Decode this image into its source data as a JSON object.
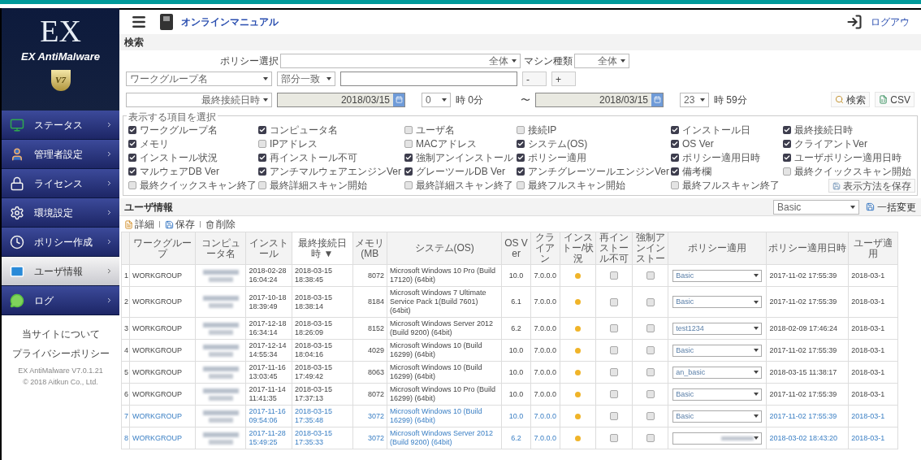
{
  "top_bar": {
    "manual_link": "オンラインマニュアル",
    "logout_link": "ログアウ"
  },
  "sidebar": {
    "logo_text": "EX",
    "product_name": "EX AntiMalware",
    "badge": "V7",
    "items": [
      {
        "kind": "status",
        "label": "ステータス",
        "selected": false
      },
      {
        "kind": "admin",
        "label": "管理者設定",
        "selected": false
      },
      {
        "kind": "license",
        "label": "ライセンス",
        "selected": false
      },
      {
        "kind": "settings",
        "label": "環境設定",
        "selected": false
      },
      {
        "kind": "policy",
        "label": "ポリシー作成",
        "selected": false
      },
      {
        "kind": "users",
        "label": "ユーザ情報",
        "selected": true
      },
      {
        "kind": "log",
        "label": "ログ",
        "selected": false
      }
    ],
    "footer_links": [
      "当サイトについて",
      "プライバシーポリシー"
    ],
    "version": "EX AntiMalware V7.0.1.21",
    "copyright": "© 2018 Aitkun Co., Ltd."
  },
  "search": {
    "title": "検索",
    "policy_label": "ポリシー選択",
    "policy_value": "全体",
    "machine_label": "マシン種類",
    "machine_value": "全体",
    "field_select": "ワークグループ名",
    "match_select": "部分一致",
    "minus_button": "-",
    "plus_button": "+",
    "date_select": "最終接続日時",
    "from_date": "2018/03/15",
    "from_hour": "0",
    "from_suffix": "時 0分",
    "range_mark": "〜",
    "to_date": "2018/03/15",
    "to_hour": "23",
    "to_suffix": "時 59分",
    "search_button": "検索",
    "csv_button": "CSV"
  },
  "columns_panel": {
    "legend": "表示する項目を選択",
    "save_button": "表示方法を保存",
    "options": [
      {
        "label": "ワークグループ名",
        "checked": true
      },
      {
        "label": "コンピュータ名",
        "checked": true
      },
      {
        "label": "ユーザ名",
        "checked": false
      },
      {
        "label": "接続IP",
        "checked": false
      },
      {
        "label": "インストール日",
        "checked": true
      },
      {
        "label": "最終接続日時",
        "checked": true
      },
      {
        "label": "メモリ",
        "checked": true
      },
      {
        "label": "IPアドレス",
        "checked": false
      },
      {
        "label": "MACアドレス",
        "checked": false
      },
      {
        "label": "システム(OS)",
        "checked": true
      },
      {
        "label": "OS Ver",
        "checked": true
      },
      {
        "label": "クライアントVer",
        "checked": true
      },
      {
        "label": "インストール状況",
        "checked": true
      },
      {
        "label": "再インストール不可",
        "checked": true
      },
      {
        "label": "強制アンインストール",
        "checked": true
      },
      {
        "label": "ポリシー適用",
        "checked": true
      },
      {
        "label": "ポリシー適用日時",
        "checked": true
      },
      {
        "label": "ユーザポリシー適用日時",
        "checked": true
      },
      {
        "label": "マルウェアDB Ver",
        "checked": true
      },
      {
        "label": "アンチマルウェアエンジンVer",
        "checked": true
      },
      {
        "label": "グレーツールDB Ver",
        "checked": true
      },
      {
        "label": "アンチグレーツールエンジンVer",
        "checked": true
      },
      {
        "label": "備考欄",
        "checked": true
      },
      {
        "label": "最終クイックスキャン開始",
        "checked": false
      },
      {
        "label": "最終クイックスキャン終了",
        "checked": false
      },
      {
        "label": "最終詳細スキャン開始",
        "checked": false
      },
      {
        "label": "最終詳細スキャン終了",
        "checked": false
      },
      {
        "label": "最終フルスキャン開始",
        "checked": false
      },
      {
        "label": "最終フルスキャン終了",
        "checked": false
      }
    ]
  },
  "user_info": {
    "title": "ユーザ情報",
    "bulk_select": "Basic",
    "bulk_button": "一括変更",
    "toolbar": [
      {
        "kind": "details",
        "label": "詳細"
      },
      {
        "kind": "save",
        "label": "保存"
      },
      {
        "kind": "delete",
        "label": "削除"
      }
    ],
    "columns": [
      "ワークグループ",
      "コンピュータ名",
      "インストール",
      "最終接続日時 ▼",
      "メモリ(MB",
      "システム(OS)",
      "OS Ver",
      "クライアン",
      "インストー/状況",
      "再インストール不可",
      "強制アンインストー",
      "ポリシー適用",
      "ポリシー適用日時",
      "ユーザ適用"
    ],
    "rows": [
      {
        "no": "1",
        "workgroup": "WORKGROUP",
        "install_date": "2018-02-28 16:04:24",
        "last_connection": "2018-03-15 18:38:45",
        "memory": "8072",
        "os": "Microsoft Windows 10 Pro (Build 17120) (64bit)",
        "os_ver": "10.0",
        "client_ver": "7.0.0.0",
        "reinstall_blocked": false,
        "force_uninstall": false,
        "policy": "Basic",
        "policy_date": "2017-11-02 17:55:39",
        "user_policy_date": "2018-03-1",
        "highlighted": false
      },
      {
        "no": "2",
        "workgroup": "WORKGROUP",
        "install_date": "2017-10-18 18:39:49",
        "last_connection": "2018-03-15 18:38:14",
        "memory": "8184",
        "os": "Microsoft Windows 7 Ultimate Service Pack 1(Build 7601) (64bit)",
        "os_ver": "6.1",
        "client_ver": "7.0.0.0",
        "reinstall_blocked": false,
        "force_uninstall": false,
        "policy": "Basic",
        "policy_date": "2017-11-02 17:55:39",
        "user_policy_date": "2018-03-1",
        "highlighted": false
      },
      {
        "no": "3",
        "workgroup": "WORKGROUP",
        "install_date": "2017-12-18 16:34:14",
        "last_connection": "2018-03-15 18:26:09",
        "memory": "8152",
        "os": "Microsoft Windows Server 2012 (Build 9200) (64bit)",
        "os_ver": "6.2",
        "client_ver": "7.0.0.0",
        "reinstall_blocked": false,
        "force_uninstall": false,
        "policy": "test1234",
        "policy_date": "2018-02-09 17:46:24",
        "user_policy_date": "2018-03-1",
        "highlighted": false
      },
      {
        "no": "4",
        "workgroup": "WORKGROUP",
        "install_date": "2017-12-14 14:55:34",
        "last_connection": "2018-03-15 18:04:16",
        "memory": "4029",
        "os": "Microsoft Windows 10 (Build 16299) (64bit)",
        "os_ver": "10.0",
        "client_ver": "7.0.0.0",
        "reinstall_blocked": false,
        "force_uninstall": false,
        "policy": "Basic",
        "policy_date": "2017-11-02 17:55:39",
        "user_policy_date": "2018-03-1",
        "highlighted": false
      },
      {
        "no": "5",
        "workgroup": "WORKGROUP",
        "install_date": "2017-11-16 13:03:45",
        "last_connection": "2018-03-15 17:49:42",
        "memory": "8063",
        "os": "Microsoft Windows 10 (Build 16299) (64bit)",
        "os_ver": "10.0",
        "client_ver": "7.0.0.0",
        "reinstall_blocked": false,
        "force_uninstall": false,
        "policy": "an_basic",
        "policy_date": "2018-03-15 11:38:17",
        "user_policy_date": "2018-03-1",
        "highlighted": false
      },
      {
        "no": "6",
        "workgroup": "WORKGROUP",
        "install_date": "2017-11-14 11:41:35",
        "last_connection": "2018-03-15 17:37:13",
        "memory": "8072",
        "os": "Microsoft Windows 10 Pro (Build 16299) (64bit)",
        "os_ver": "10.0",
        "client_ver": "7.0.0.0",
        "reinstall_blocked": false,
        "force_uninstall": false,
        "policy": "Basic",
        "policy_date": "2017-11-02 17:55:39",
        "user_policy_date": "2018-03-1",
        "highlighted": false
      },
      {
        "no": "7",
        "workgroup": "WORKGROUP",
        "install_date": "2017-11-16 09:54:06",
        "last_connection": "2018-03-15 17:35:48",
        "memory": "3072",
        "os": "Microsoft Windows 10 (Build 16299) (64bit)",
        "os_ver": "10.0",
        "client_ver": "7.0.0.0",
        "reinstall_blocked": false,
        "force_uninstall": false,
        "policy": "Basic",
        "policy_date": "2017-11-02 17:55:39",
        "user_policy_date": "2018-03-1",
        "highlighted": true
      },
      {
        "no": "8",
        "workgroup": "WORKGROUP",
        "install_date": "2017-11-28 15:49:25",
        "last_connection": "2018-03-15 17:35:33",
        "memory": "3072",
        "os": "Microsoft Windows Server 2012 (Build 9200) (64bit)",
        "os_ver": "6.2",
        "client_ver": "7.0.0.0",
        "reinstall_blocked": false,
        "force_uninstall": false,
        "policy_date": "2018-03-02 18:43:20",
        "user_policy_date": "2018-03-1",
        "highlighted": true
      }
    ]
  }
}
